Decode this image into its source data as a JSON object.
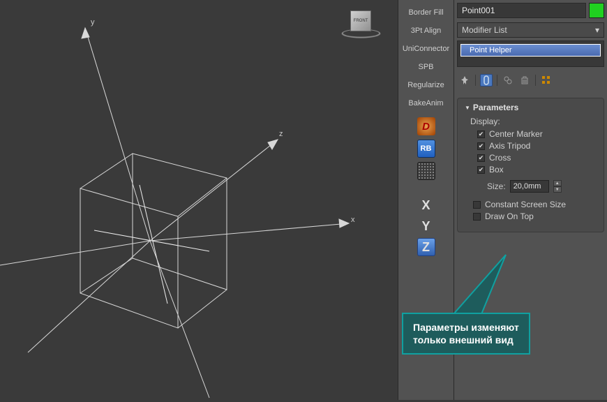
{
  "viewport": {
    "axis_labels": {
      "x": "x",
      "y": "y",
      "z": "z"
    },
    "viewcube_face": "FRONT"
  },
  "tool_column": {
    "border_fill": "Border Fill",
    "threept_align": "3Pt Align",
    "uniconnector": "UniConnector",
    "spb": "SPB",
    "regularize": "Regularize",
    "bakeanim": "BakeAnim",
    "icon_d": "D",
    "icon_rb": "RB",
    "axis_x": "X",
    "axis_y": "Y",
    "axis_z": "Z"
  },
  "panel": {
    "object_name": "Point001",
    "modifier_list_label": "Modifier List",
    "modifier_stack_item": "Point Helper",
    "rollout_title": "Parameters",
    "display_label": "Display:",
    "center_marker": "Center Marker",
    "axis_tripod": "Axis Tripod",
    "cross": "Cross",
    "box": "Box",
    "size_label": "Size:",
    "size_value": "20,0mm",
    "constant_screen": "Constant Screen Size",
    "draw_on_top": "Draw On Top"
  },
  "callout": {
    "line1": "Параметры изменяют",
    "line2": "только внешний вид"
  }
}
